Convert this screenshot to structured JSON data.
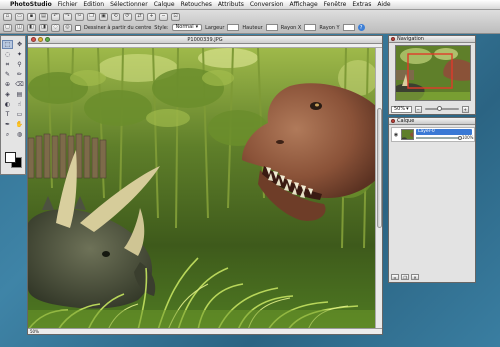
{
  "menubar": {
    "apple": "",
    "app_name": "PhotoStudio",
    "items": [
      "Fichier",
      "Edition",
      "Sélectionner",
      "Calque",
      "Retouches",
      "Attributs",
      "Conversion",
      "Affichage",
      "Fenêtre",
      "Extras",
      "Aide"
    ]
  },
  "options": {
    "deselect_center_label": "Dessiner à partir du centre",
    "style_label": "Style:",
    "style_value": "Normal",
    "width_label": "Largeur",
    "height_label": "Hauteur",
    "radius_x_label": "Rayon X",
    "radius_y_label": "Rayon Y",
    "help_glyph": "?"
  },
  "tools": {
    "icons": [
      "marquee-rect-icon",
      "move-icon",
      "lasso-icon",
      "magic-wand-icon",
      "crop-icon",
      "eyedropper-icon",
      "brush-icon",
      "pencil-icon",
      "clone-stamp-icon",
      "eraser-icon",
      "bucket-icon",
      "gradient-icon",
      "dodge-icon",
      "smudge-icon",
      "text-icon",
      "shape-icon",
      "pen-icon",
      "hand-icon",
      "zoom-icon",
      "sponge-icon"
    ],
    "glyphs": [
      "⬚",
      "✥",
      "◌",
      "✦",
      "⌗",
      "⚲",
      "✎",
      "✏",
      "⊕",
      "⌫",
      "◈",
      "▤",
      "◐",
      "☝",
      "T",
      "▭",
      "✒",
      "✋",
      "⌕",
      "◍"
    ],
    "active_index": 0
  },
  "document": {
    "title": "P1000339.JPG",
    "zoom_status": "50%"
  },
  "navigation": {
    "title": "Navigation",
    "zoom_value": "50%"
  },
  "layers": {
    "title": "Calque",
    "layer_name": "Layer-0",
    "opacity": "100%"
  },
  "colors": {
    "selection_box": "#e03a2a",
    "layer_highlight": "#3a79d5",
    "desktop": "#2f6d8e"
  }
}
